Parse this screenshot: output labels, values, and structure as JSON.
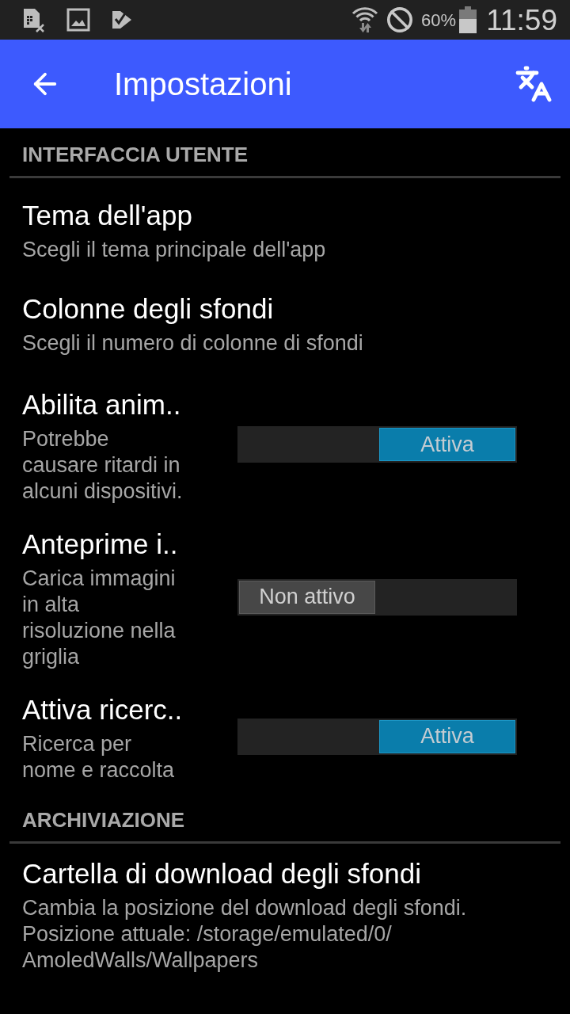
{
  "status_bar": {
    "battery_percent": "60%",
    "time": "11:59"
  },
  "toolbar": {
    "title": "Impostazioni"
  },
  "sections": [
    {
      "header": "INTERFACCIA UTENTE",
      "items": [
        {
          "kind": "plain",
          "title": "Tema dell'app",
          "summary": "Scegli il tema principale dell'app"
        },
        {
          "kind": "plain",
          "title": "Colonne degli sfondi",
          "summary": "Scegli il numero di colonne di sfondi"
        },
        {
          "kind": "toggle",
          "title": "Abilita anim..",
          "summary": "Potrebbe causare ritardi in alcuni dispositivi.",
          "toggle": {
            "on": true,
            "label": "Attiva"
          }
        },
        {
          "kind": "toggle",
          "title": "Anteprime i..",
          "summary": "Carica immagini in alta risoluzione nella griglia",
          "toggle": {
            "on": false,
            "label": "Non attivo"
          }
        },
        {
          "kind": "toggle",
          "title": "Attiva ricerc..",
          "summary": "Ricerca per nome e raccolta",
          "toggle": {
            "on": true,
            "label": "Attiva"
          }
        }
      ]
    },
    {
      "header": "ARCHIVIAZIONE",
      "items": [
        {
          "kind": "plain",
          "title": "Cartella di download degli sfondi",
          "summary": "Cambia la posizione del download degli sfondi. Posizione attuale: /storage/emulated/0/AmoledWalls/Wallpapers"
        }
      ]
    }
  ]
}
